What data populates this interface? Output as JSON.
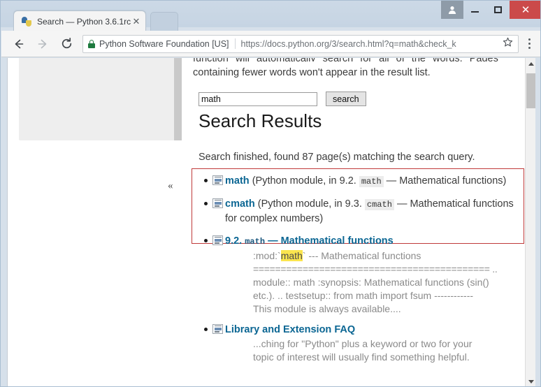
{
  "window": {
    "profile_icon": "person-icon",
    "minimize_label": "—",
    "maximize_label": "□",
    "close_label": "✕",
    "accent_close": "#cb4a4a"
  },
  "tab": {
    "title": "Search — Python 3.6.1rc",
    "close_label": "✕",
    "favicon": "python-logo-icon"
  },
  "toolbar": {
    "back_icon": "back-arrow-icon",
    "forward_icon": "forward-arrow-icon",
    "reload_icon": "reload-icon",
    "lock_icon": "lock-icon",
    "ev_issuer": "Python Software Foundation [US]",
    "url_scheme": "https://",
    "url_host": "docs.python.org",
    "url_path": "/3/search.html?q=math&check_k",
    "url_full": "https://docs.python.org/3/search.html?q=math&check_k",
    "star_icon": "star-icon",
    "menu_icon": "three-dots-menu-icon"
  },
  "page": {
    "cut_text": "function will automatically search for all of the words. Pages",
    "intro_text": "containing fewer words won't appear in the result list.",
    "search_value": "math",
    "search_placeholder": "",
    "search_button": "search",
    "heading": "Search Results",
    "summary": "Search finished, found 87 page(s) matching the search query.",
    "sidebar_toggle": "«",
    "highlight_color": "#c03a3a",
    "link_color": "#0b6693",
    "results": [
      {
        "icon": "page-icon",
        "link": "math",
        "before": "(Python module, in 9.2. ",
        "code": "math",
        "after": " — Mathematical functions)",
        "context": "",
        "in_redbox": true
      },
      {
        "icon": "page-icon",
        "link": "cmath",
        "before": "(Python module, in 9.3. ",
        "code": "cmath",
        "after": " — Mathematical functions for complex numbers)",
        "context": "",
        "in_redbox": true
      },
      {
        "icon": "page-icon",
        "link_prefix": "9.2.",
        "link_code": "math",
        "link_suffix": "— Mathematical functions",
        "context_1_pre": ":mod:`",
        "context_1_hl": "math",
        "context_1_post": "` --- Mathematical functions",
        "context_2": "=========================================== ..",
        "context_3": "module:: math :synopsis: Mathematical functions (sin()",
        "context_4": "etc.). .. testsetup:: from math import fsum ------------",
        "context_5": "This module is always available....",
        "in_redbox": false
      },
      {
        "icon": "page-icon",
        "link": "Library and Extension FAQ",
        "context_1": "...ching for \"Python\" plus a keyword or two for your",
        "context_2": "topic of interest will usually find something helpful.",
        "in_redbox": false
      }
    ]
  },
  "scrollbars": {
    "page_up_icon": "scroll-up-arrow-icon",
    "page_down_icon": "scroll-down-arrow-icon",
    "page_thumb": "scroll-thumb"
  }
}
